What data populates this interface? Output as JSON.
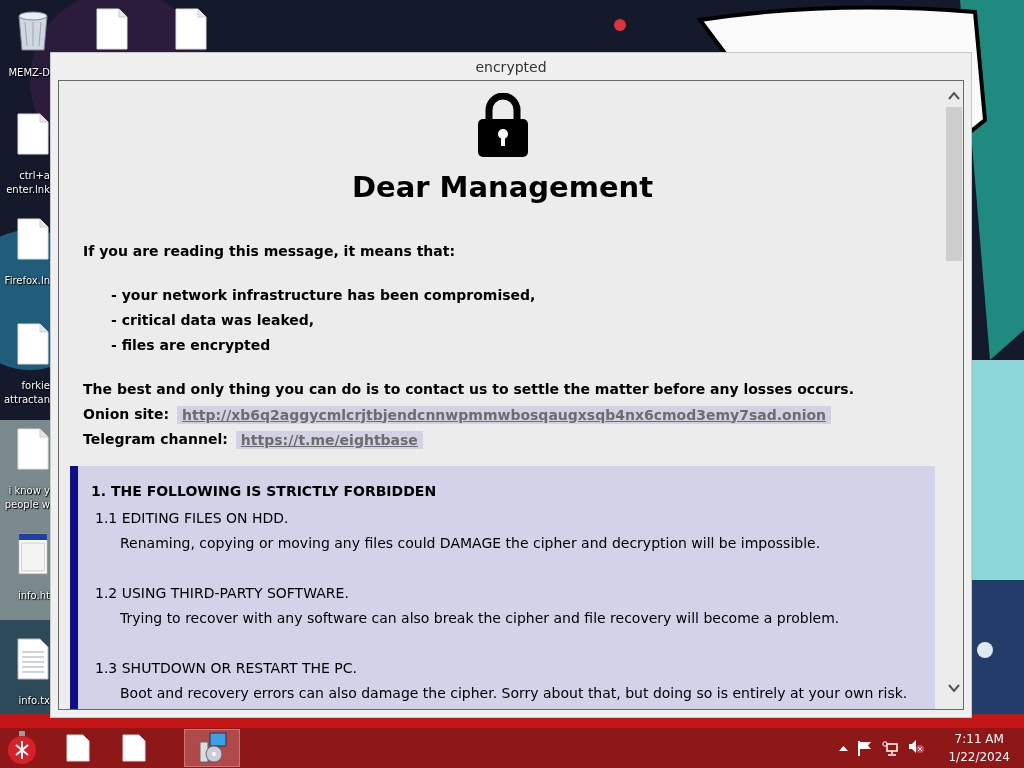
{
  "desktop_columns": [
    [
      {
        "kind": "bin",
        "lines": [
          "MEMZ-D"
        ]
      },
      {
        "kind": "file",
        "lines": [
          "ctrl+a",
          "enter.lnk"
        ]
      },
      {
        "kind": "file",
        "lines": [
          "Firefox.ln"
        ]
      },
      {
        "kind": "file",
        "lines": [
          "forkie",
          "attractan"
        ]
      },
      {
        "kind": "file",
        "lines": [
          "i know y",
          "people w"
        ]
      },
      {
        "kind": "web",
        "lines": [
          "info.ht"
        ]
      },
      {
        "kind": "text",
        "lines": [
          "info.tx"
        ]
      }
    ],
    [
      {
        "kind": "file"
      }
    ],
    [
      {
        "kind": "file"
      }
    ]
  ],
  "window": {
    "title": "encrypted",
    "heading": "Dear Management",
    "intro": "If you are reading this message, it means that:",
    "points": [
      "- your network infrastructure has been compromised,",
      "- critical data was leaked,",
      "- files are encrypted"
    ],
    "advice": "The best and only thing you can do is to contact us to settle the matter before any losses occurs.",
    "contacts": [
      {
        "label": "Onion site:",
        "link": "http://xb6q2aggycmlcrjtbjendcnnwpmmwbosqaugxsqb4nx6cmod3emy7sad.onion"
      },
      {
        "label": "Telegram channel:",
        "link": "https://t.me/eightbase"
      }
    ],
    "notice": {
      "heading": "1. THE FOLLOWING IS STRICTLY FORBIDDEN",
      "rules": [
        {
          "title": "1.1 EDITING FILES ON HDD.",
          "text": "Renaming, copying or moving any files could DAMAGE the cipher and decryption will be impossible."
        },
        {
          "title": "1.2 USING THIRD-PARTY SOFTWARE.",
          "text": "Trying to recover with any software can also break the cipher and file recovery will become a problem."
        },
        {
          "title": "1.3 SHUTDOWN OR RESTART THE PC.",
          "text": "Boot and recovery errors can also damage the cipher. Sorry about that, but doing so is entirely at your own risk."
        }
      ]
    }
  },
  "taskbar": {
    "apps": [
      {
        "kind": "ornament",
        "selected": false
      },
      {
        "kind": "file",
        "selected": false
      },
      {
        "kind": "file",
        "selected": false
      },
      {
        "kind": "installer",
        "selected": true
      }
    ],
    "tray": {
      "volume_muted": true,
      "time": "7:11 AM",
      "date": "1/22/2024"
    }
  }
}
